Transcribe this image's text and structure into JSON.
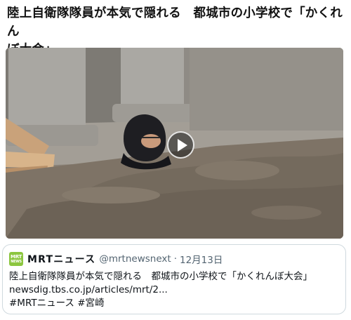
{
  "post": {
    "headline_line1": "陸上自衛隊隊員が本気で隠れる　都城市の小学校で「かくれん",
    "headline_line2": "ぼ大会」"
  },
  "video": {
    "play_icon": "play-icon"
  },
  "quoted_post": {
    "avatar_line1": "MRT",
    "avatar_line2": "NEWS",
    "display_name": "MRTニュース",
    "handle": "@mrtnewsnext",
    "separator": "·",
    "date": "12月13日",
    "text": "陸上自衛隊隊員が本気で隠れる　都城市の小学校で「かくれんぼ大会」",
    "link": "newsdig.tbs.co.jp/articles/mrt/2...",
    "hashtag1": "#MRTニュース",
    "hashtag2": "#宮崎"
  }
}
